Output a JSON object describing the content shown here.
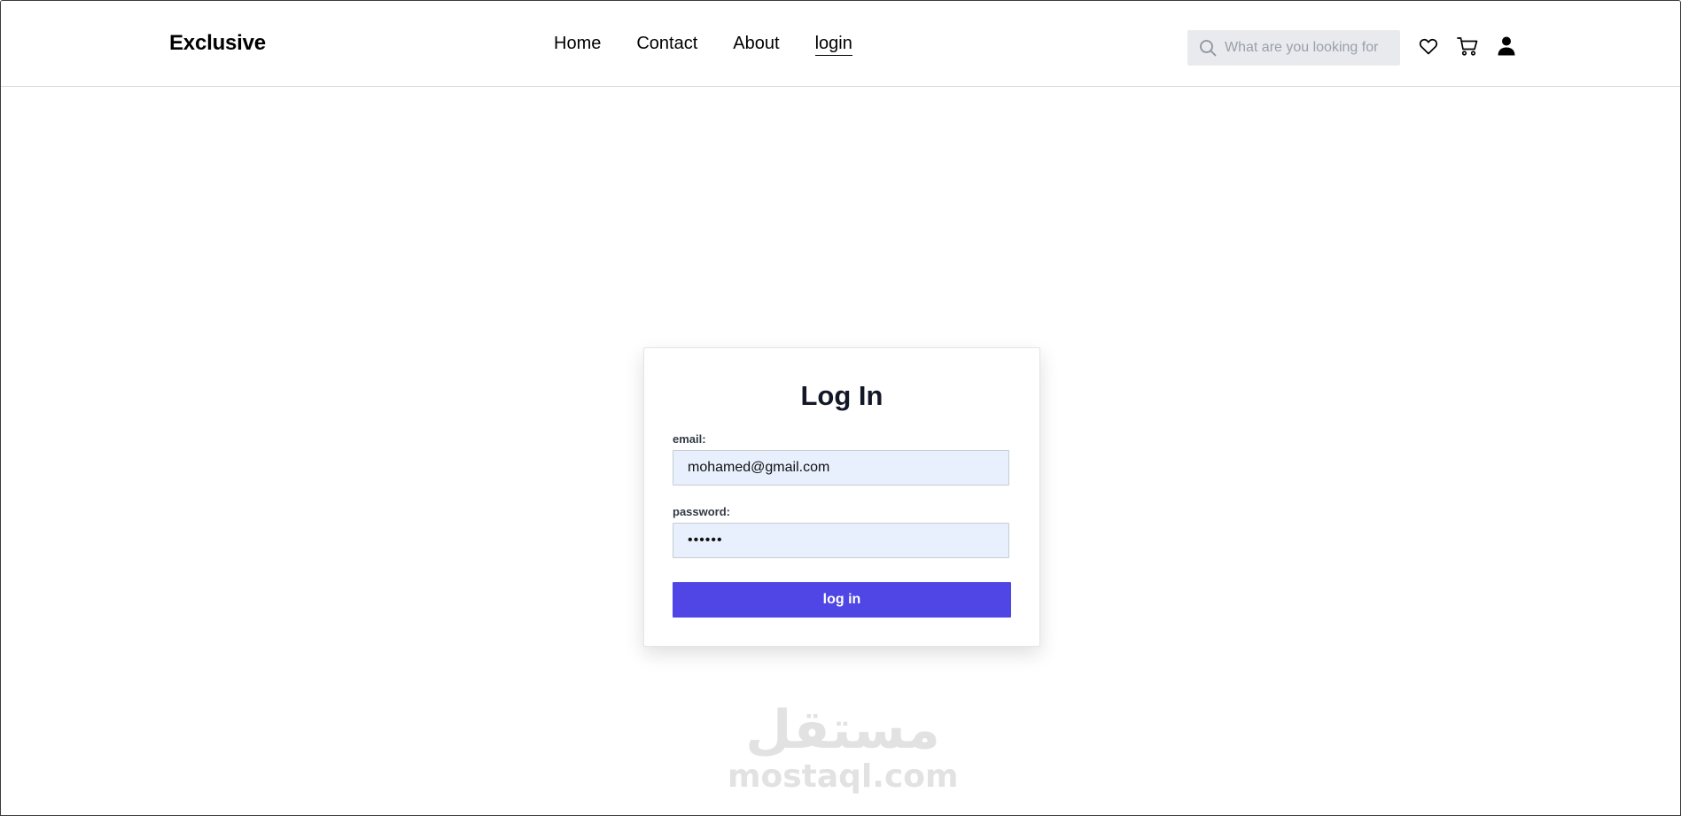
{
  "header": {
    "brand": "Exclusive",
    "nav": [
      {
        "label": "Home"
      },
      {
        "label": "Contact"
      },
      {
        "label": "About"
      },
      {
        "label": "login",
        "active": true
      }
    ],
    "search": {
      "placeholder": "What are you looking for",
      "icon": "search-icon"
    },
    "icons": [
      "heart-icon",
      "cart-icon",
      "user-icon"
    ]
  },
  "login": {
    "title": "Log In",
    "email_label": "email:",
    "email_value": "mohamed@gmail.com",
    "password_label": "password:",
    "password_value": "••••••",
    "button_label": "log in"
  },
  "watermark": {
    "arabic": "مستقل",
    "latin": "mostaql.com"
  },
  "colors": {
    "accent": "#4f46e5",
    "input_bg": "#e8f0fe",
    "search_bg": "#e8eaee",
    "title": "#111827"
  }
}
